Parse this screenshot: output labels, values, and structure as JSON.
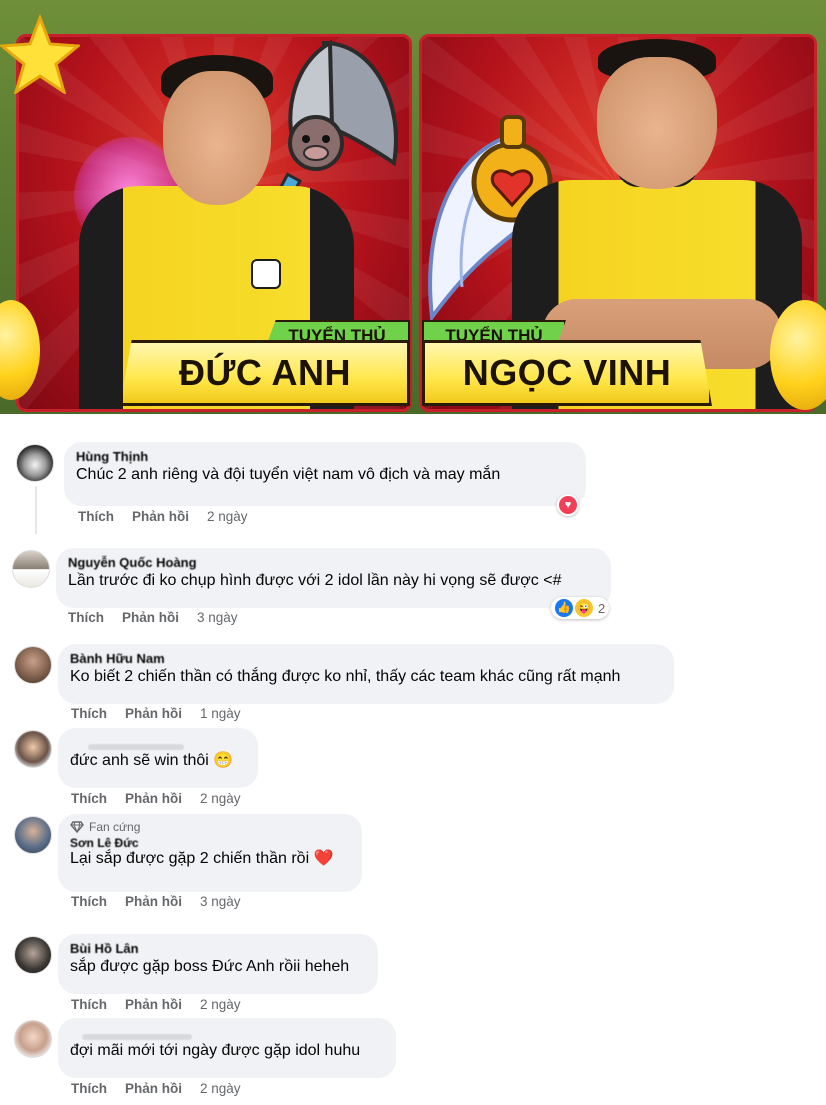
{
  "banner": {
    "left_player": {
      "tag": "TUYỂN THỦ",
      "name": "ĐỨC ANH"
    },
    "right_player": {
      "tag": "TUYỂN THỦ",
      "name": "NGỌC VINH"
    }
  },
  "actions": {
    "like": "Thích",
    "reply": "Phản hồi"
  },
  "comments": [
    {
      "author": "Hùng Thịnh",
      "text": "Chúc 2 anh riêng và đội tuyển việt nam vô địch và may mắn",
      "time": "2 ngày",
      "reaction": "heart-icon"
    },
    {
      "author": "Nguyễn Quốc Hoàng",
      "text": "Lần trước đi ko chụp hình được với 2 idol lần này hi vọng sẽ được <#",
      "time": "3 ngày",
      "reaction_count": "2"
    },
    {
      "author": "Bành Hữu Nam",
      "text": "Ko biết 2 chiến thần có thắng được ko nhỉ, thấy các team khác cũng rất mạnh",
      "time": "1 ngày"
    },
    {
      "author": "",
      "text": "đức anh sẽ win thôi 😁",
      "time": "2 ngày"
    },
    {
      "badge": "Fan cứng",
      "author": "Sơn Lê Đức",
      "text": "Lại sắp được gặp 2 chiến thần rồi ❤️",
      "time": "3 ngày"
    },
    {
      "author": "Bùi Hồ Lân",
      "text": "sắp được gặp boss Đức Anh rồii heheh",
      "time": "2 ngày"
    },
    {
      "author": "",
      "text": "đợi mãi mới tới ngày được gặp idol huhu",
      "time": "2 ngày"
    }
  ],
  "colors": {
    "bubble": "#f0f2f5",
    "meta": "#65676b",
    "like_blue": "#1877f2",
    "heart_red": "#f33e58"
  }
}
